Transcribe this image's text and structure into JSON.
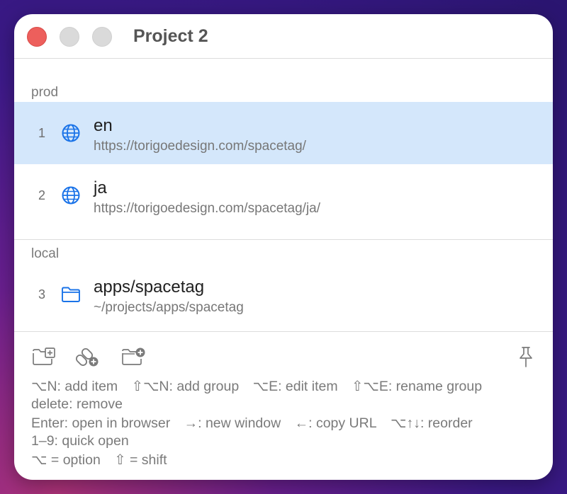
{
  "window": {
    "title": "Project 2"
  },
  "groups": [
    {
      "label": "prod",
      "items": [
        {
          "number": "1",
          "name": "en",
          "url": "https://torigoedesign.com/spacetag/",
          "icon": "globe-icon"
        },
        {
          "number": "2",
          "name": "ja",
          "url": "https://torigoedesign.com/spacetag/ja/",
          "icon": "globe-icon"
        }
      ]
    },
    {
      "label": "local",
      "items": [
        {
          "number": "3",
          "name": "apps/spacetag",
          "url": "~/projects/apps/spacetag",
          "icon": "folder-icon"
        }
      ]
    }
  ],
  "help": {
    "line1": [
      "⌥N: add item",
      "⇧⌥N: add group",
      "⌥E: edit item",
      "⇧⌥E: rename group"
    ],
    "line2": [
      "delete: remove"
    ],
    "line3": [
      "Enter: open in browser",
      "→: new window",
      "←: copy URL",
      "⌥↑↓: reorder"
    ],
    "line4": [
      "1–9: quick open"
    ],
    "line5": [
      "⌥ = option",
      "⇧ = shift"
    ]
  },
  "colors": {
    "accent": "#1a73e8",
    "selection": "#d4e7fb",
    "close": "#ed5f5c"
  }
}
